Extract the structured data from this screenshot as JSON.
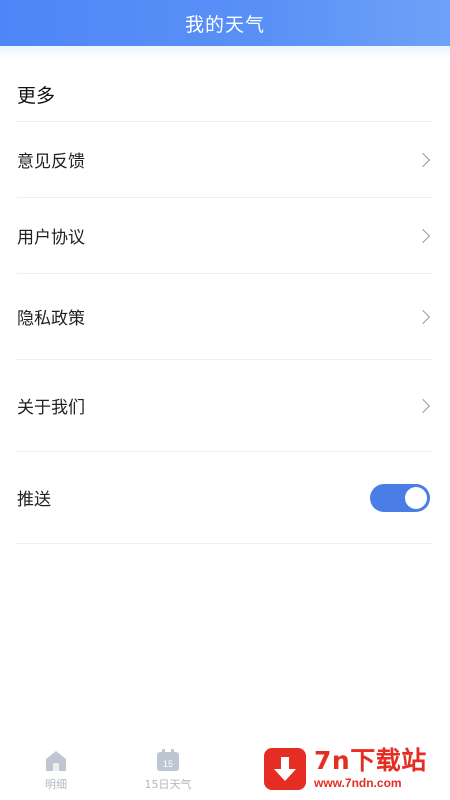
{
  "header": {
    "title": "我的天气"
  },
  "section": {
    "title": "更多"
  },
  "menu": {
    "items": [
      {
        "label": "意见反馈"
      },
      {
        "label": "用户协议"
      },
      {
        "label": "隐私政策"
      },
      {
        "label": "关于我们"
      }
    ]
  },
  "push": {
    "label": "推送",
    "enabled": true
  },
  "tabbar": {
    "tabs": [
      {
        "label": "明细",
        "icon": "home-icon"
      },
      {
        "label": "15日天气",
        "icon": "calendar-icon",
        "icon_text": "15"
      }
    ]
  },
  "watermark": {
    "title": "7n下载站",
    "url": "www.7ndn.com"
  },
  "colors": {
    "accent": "#4a7de6",
    "header": "#5a91f6",
    "watermark": "#e52d24"
  }
}
